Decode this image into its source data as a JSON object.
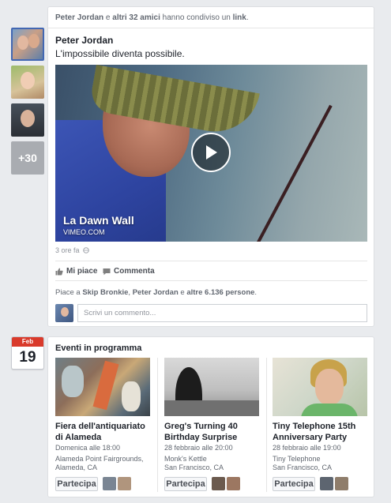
{
  "story": {
    "header": {
      "name1": "Peter Jordan",
      "connector": "e",
      "name2": "altri 32 amici",
      "verb": "hanno condiviso un",
      "object": "link",
      "end": "."
    },
    "stack_more": "+30",
    "author": "Peter Jordan",
    "text": "L'impossibile diventa possibile.",
    "video": {
      "title": "La Dawn Wall",
      "source": "VIMEO.COM"
    },
    "time": "3 ore fa",
    "actions": {
      "like": "Mi piace",
      "comment": "Commenta"
    },
    "likes": {
      "prefix": "Piace a",
      "name1": "Skip Bronkie",
      "sep": ",",
      "name2": "Peter Jordan",
      "connector": "e",
      "others": "altre 6.136 persone",
      "end": "."
    },
    "comment_placeholder": "Scrivi un commento..."
  },
  "events": {
    "calendar": {
      "month": "Feb",
      "day": "19"
    },
    "title": "Eventi in programma",
    "items": [
      {
        "title": "Fiera dell'antiquariato di Alameda",
        "date": "Domenica alle 18:00",
        "place": "Alameda Point Fairgrounds,",
        "city": "Alameda, CA",
        "join": "Partecipa"
      },
      {
        "title": "Greg's Turning 40 Birthday Surprise",
        "date": "28 febbraio alle 20:00",
        "place": "Monk's Kettle",
        "city": "San Francisco, CA",
        "join": "Partecipa"
      },
      {
        "title": "Tiny Telephone 15th Anniversary Party",
        "date": "28 febbraio alle 19:00",
        "place": "Tiny Telephone",
        "city": "San Francisco, CA",
        "join": "Partecipa"
      }
    ]
  },
  "colors": {
    "link": "#365899",
    "text": "#1d2129",
    "muted": "#90949c",
    "background": "#e9ebee",
    "calendar_red": "#d93a2b"
  }
}
